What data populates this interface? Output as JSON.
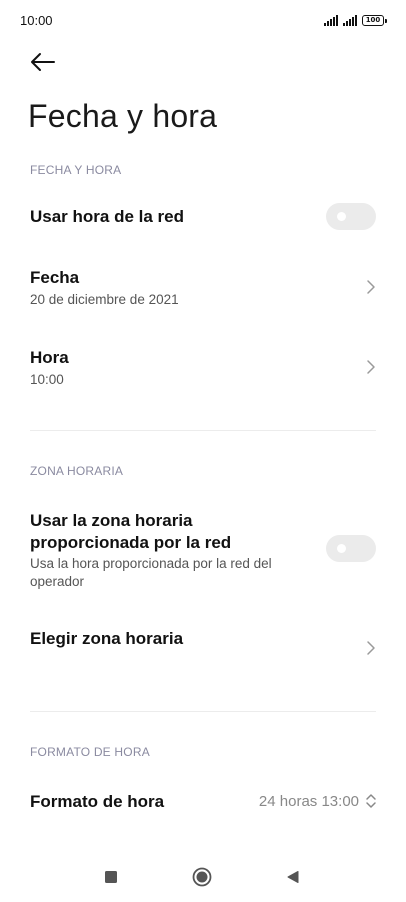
{
  "status_bar": {
    "time": "10:00",
    "battery": "100",
    "icons": [
      "signal-icon",
      "signal-icon",
      "battery-icon"
    ]
  },
  "header": {
    "back_icon": "arrow-left-icon",
    "title": "Fecha y hora"
  },
  "sections": {
    "date_time": {
      "header": "FECHA Y HORA",
      "network_time": {
        "label": "Usar hora de la red",
        "enabled": false
      },
      "date": {
        "label": "Fecha",
        "value": "20 de diciembre de 2021"
      },
      "time": {
        "label": "Hora",
        "value": "10:00"
      }
    },
    "time_zone": {
      "header": "ZONA HORARIA",
      "network_zone": {
        "label_line1": "Usar la zona horaria",
        "label_line2": "proporcionada por la red",
        "description_line1": "Usa la hora proporcionada por la red del",
        "description_line2": "operador",
        "enabled": false
      },
      "choose_zone": {
        "label": "Elegir zona horaria"
      }
    },
    "time_format": {
      "header": "FORMATO DE HORA",
      "format": {
        "label": "Formato de hora",
        "value": "24 horas 13:00"
      }
    }
  },
  "nav_bar": {
    "icons": [
      "recents-square-icon",
      "home-circle-icon",
      "back-triangle-icon"
    ]
  },
  "colors": {
    "toggle_off": "#ebebeb",
    "section_header": "#8a8aa0",
    "divider": "#ececec"
  }
}
